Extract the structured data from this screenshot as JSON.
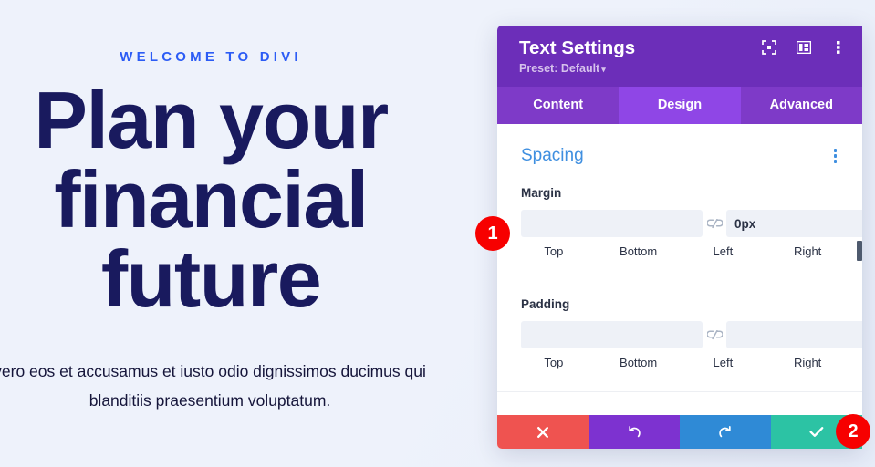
{
  "page": {
    "eyebrow": "WELCOME TO DIVI",
    "headline": "Plan your financial future",
    "body": "vero eos et accusamus et iusto odio dignissimos ducimus qui blanditiis praesentium voluptatum.",
    "colors": {
      "background": "#eef2fb",
      "eyebrow": "#2c5cf5",
      "headline": "#191a5e",
      "body": "#15153a"
    }
  },
  "panel": {
    "title": "Text Settings",
    "preset_label": "Preset: Default",
    "preset_caret": "▾",
    "header_icons": [
      {
        "name": "focus-target-icon"
      },
      {
        "name": "layout-columns-icon"
      },
      {
        "name": "more-vertical-icon"
      }
    ],
    "tabs": [
      {
        "label": "Content",
        "active": false
      },
      {
        "label": "Design",
        "active": true
      },
      {
        "label": "Advanced",
        "active": false
      }
    ],
    "section": {
      "title": "Spacing",
      "menu_icon": "more-vertical-icon"
    },
    "margin": {
      "label": "Margin",
      "top": {
        "value": "",
        "placeholder": ""
      },
      "bottom": {
        "value": "0px",
        "placeholder": ""
      },
      "left": {
        "value": "",
        "placeholder": ""
      },
      "right": {
        "value": "",
        "placeholder": ""
      },
      "captions": [
        "Top",
        "Bottom",
        "Left",
        "Right"
      ],
      "link_icon": "broken-link-icon"
    },
    "padding": {
      "label": "Padding",
      "top": {
        "value": "",
        "placeholder": ""
      },
      "bottom": {
        "value": "",
        "placeholder": ""
      },
      "left": {
        "value": "",
        "placeholder": ""
      },
      "right": {
        "value": "",
        "placeholder": ""
      },
      "captions": [
        "Top",
        "Bottom",
        "Left",
        "Right"
      ],
      "link_icon": "broken-link-icon"
    },
    "footer": [
      {
        "name": "cancel-button",
        "icon": "close-x-icon",
        "color": "#ef5350"
      },
      {
        "name": "undo-button",
        "icon": "undo-arrow-icon",
        "color": "#7d32d0"
      },
      {
        "name": "redo-button",
        "icon": "redo-arrow-icon",
        "color": "#2f8ad6"
      },
      {
        "name": "save-button",
        "icon": "check-icon",
        "color": "#2cc3a4"
      }
    ],
    "colors": {
      "header": "#6c2eb9",
      "tabs": "#7e3ac8",
      "tab_active": "#8f46e6",
      "section_title": "#3f8fe0",
      "input_bg": "#eef1f7"
    }
  },
  "badges": [
    {
      "label": "1",
      "color": "#f70000"
    },
    {
      "label": "2",
      "color": "#f70000"
    }
  ]
}
